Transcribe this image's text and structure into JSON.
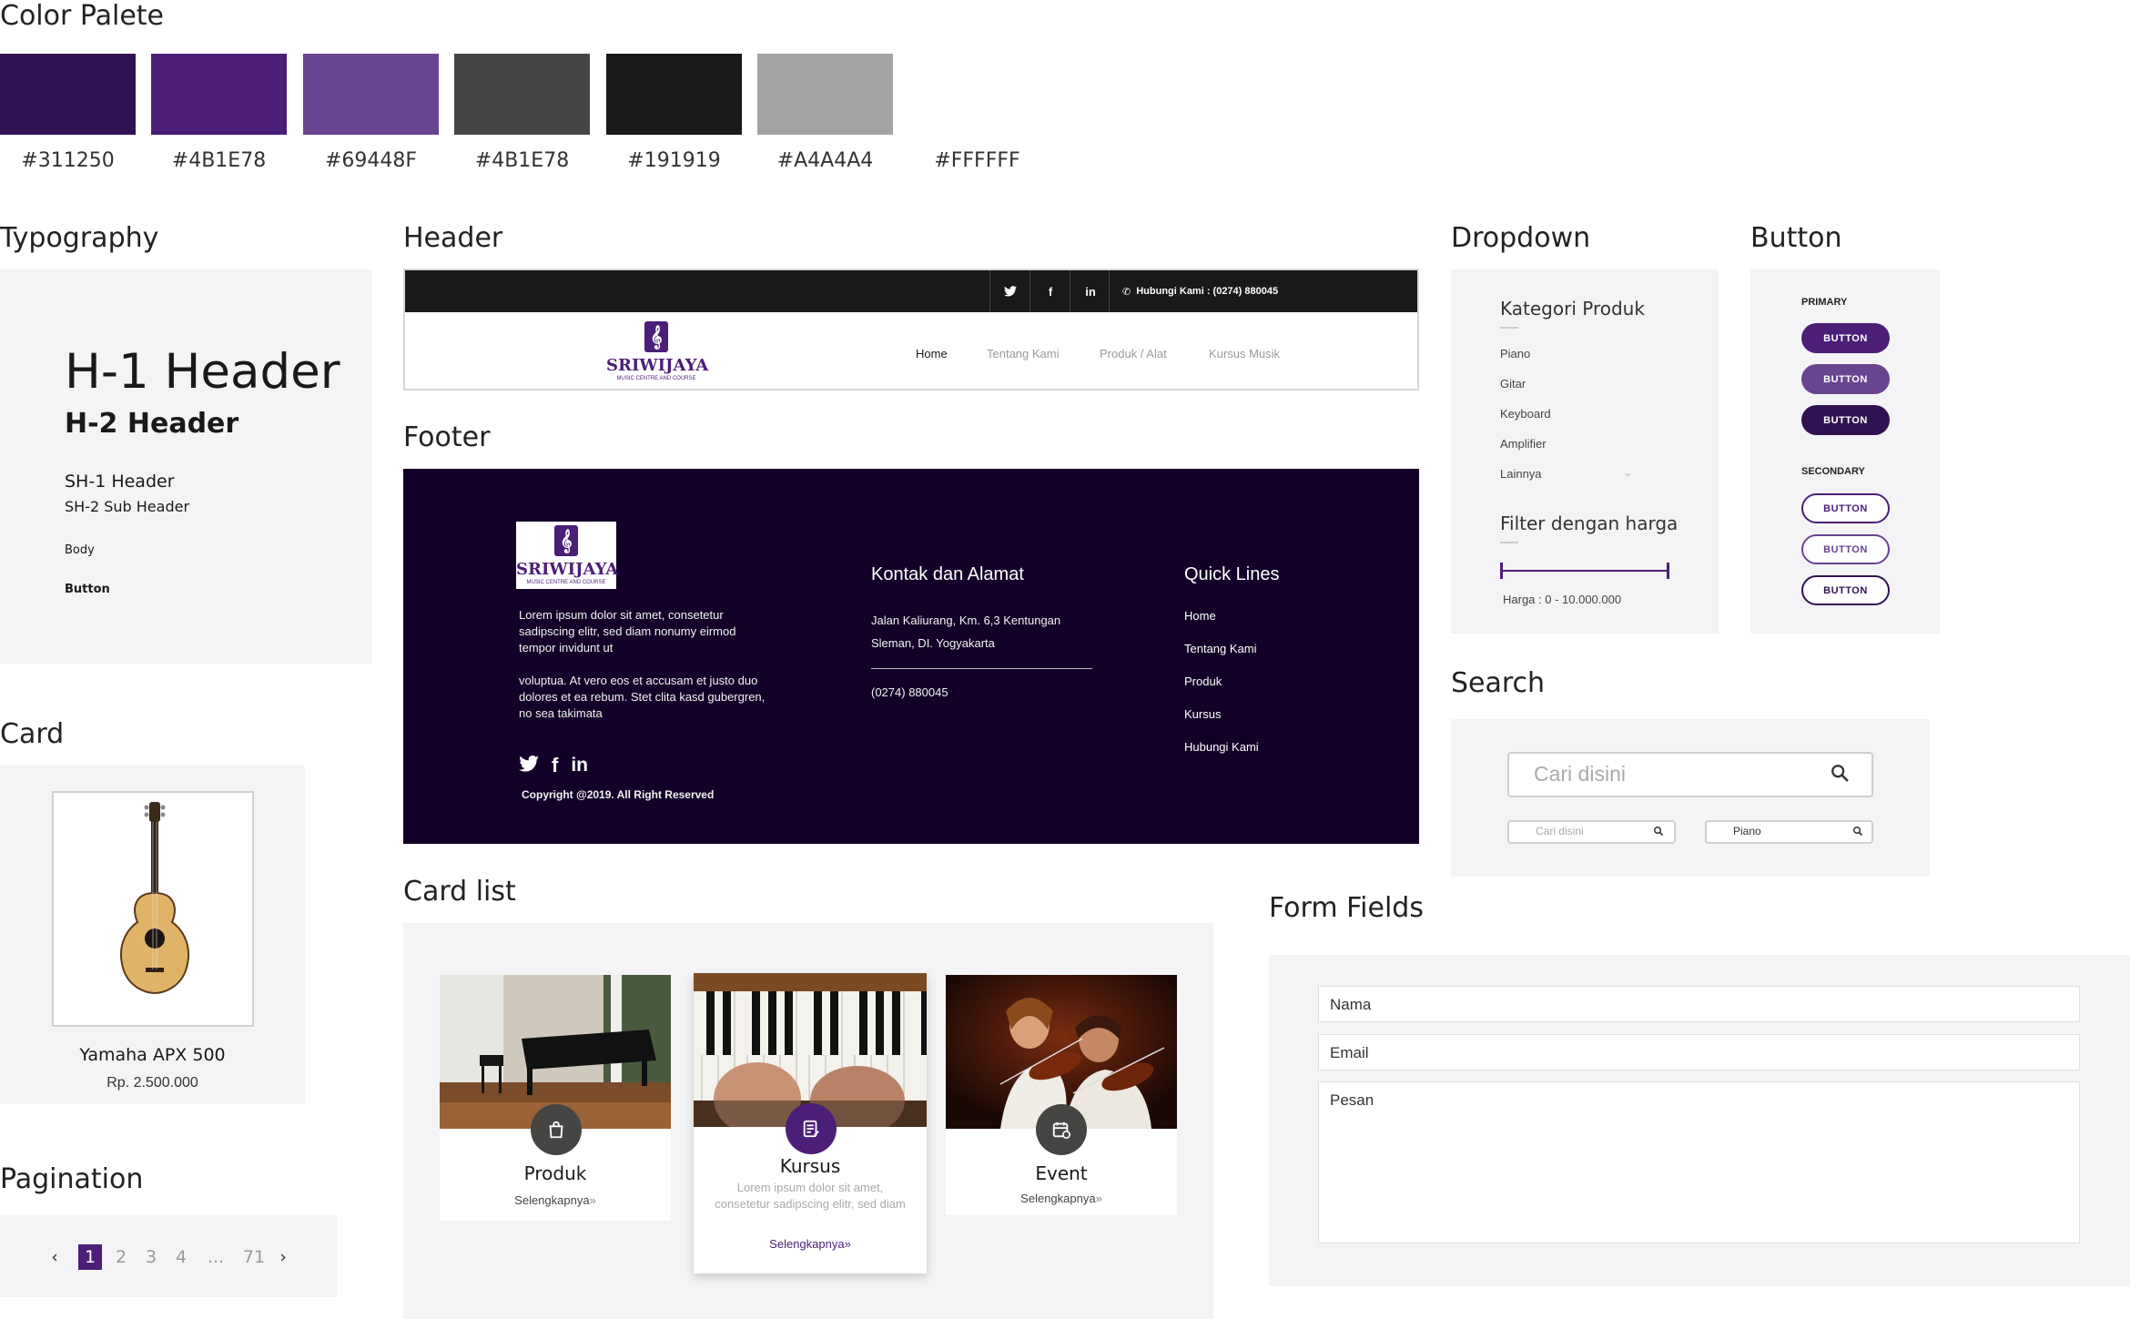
{
  "palette": {
    "title": "Color Palete",
    "swatches": [
      {
        "hex": "#311250",
        "label": "#311250"
      },
      {
        "hex": "#4B1E78",
        "label": "#4B1E78"
      },
      {
        "hex": "#69448F",
        "label": "#69448F"
      },
      {
        "hex": "#454543",
        "label": "#4B1E78"
      },
      {
        "hex": "#191919",
        "label": "#191919"
      },
      {
        "hex": "#A4A4A4",
        "label": "#A4A4A4"
      },
      {
        "hex": "#FFFFFF",
        "label": "#FFFFFF"
      }
    ]
  },
  "typography": {
    "title": "Typography",
    "h1": "H-1 Header",
    "h2": "H-2 Header",
    "sh1": "SH-1 Header",
    "sh2": "SH-2 Sub Header",
    "body": "Body",
    "button": "Button"
  },
  "header": {
    "title": "Header",
    "social": [
      "twitter-icon",
      "facebook-icon",
      "linkedin-icon"
    ],
    "social_glyphs": [
      "🐦",
      "f",
      "in"
    ],
    "contact": "Hubungi Kami : (0274) 880045",
    "nav": [
      "Home",
      "Tentang Kami",
      "Produk / Alat",
      "Kursus Musik"
    ],
    "active_nav": "Home"
  },
  "logo": {
    "name": "SRIWIJAYA",
    "sub": "MUSIC CENTRE AND COURSE"
  },
  "footer": {
    "title": "Footer",
    "para1": "Lorem ipsum dolor sit amet, consetetur sadipscing elitr, sed diam nonumy eirmod tempor invidunt ut",
    "para2": "voluptua. At vero eos et accusam et justo duo dolores et ea rebum. Stet clita kasd gubergren, no sea takimata",
    "copyright": "Copyright @2019. All Right Reserved",
    "contact_title": "Kontak dan Alamat",
    "address1": "Jalan Kaliurang, Km. 6,3 Kentungan",
    "address2": "Sleman, DI. Yogyakarta",
    "phone": "(0274) 880045",
    "links_title": "Quick Lines",
    "links": [
      "Home",
      "Tentang Kami",
      "Produk",
      "Kursus",
      "Hubungi Kami"
    ]
  },
  "dropdown": {
    "title": "Dropdown",
    "category_title": "Kategori Produk",
    "items": [
      "Piano",
      "Gitar",
      "Keyboard",
      "Amplifier",
      "Lainnya"
    ],
    "filter_title": "Filter dengan harga",
    "range_min": 0,
    "range_max": 10000000,
    "price_label": "Harga : 0 - 10.000.000"
  },
  "buttons": {
    "title": "Button",
    "primary_label": "PRIMARY",
    "secondary_label": "SECONDARY",
    "primary": [
      "BUTTON",
      "BUTTON",
      "BUTTON"
    ],
    "secondary": [
      "BUTTON",
      "BUTTON",
      "BUTTON"
    ]
  },
  "search": {
    "title": "Search",
    "placeholder_big": "Cari disini",
    "placeholder_small": "Cari disini",
    "value_small": "Piano"
  },
  "card": {
    "title": "Card",
    "product_name": "Yamaha APX 500",
    "price": "Rp. 2.500.000"
  },
  "pagination": {
    "title": "Pagination",
    "pages": [
      "1",
      "2",
      "3",
      "4",
      "...",
      "71"
    ],
    "current": "1"
  },
  "card_list": {
    "title": "Card list",
    "cards": [
      {
        "title": "Produk",
        "link": "Selengkapnya",
        "icon": "shopping-bag-icon"
      },
      {
        "title": "Kursus",
        "desc": "Lorem ipsum dolor sit amet, consetetur sadipscing elitr, sed diam",
        "link": "Selengkapnya",
        "icon": "document-icon"
      },
      {
        "title": "Event",
        "link": "Selengkapnya",
        "icon": "calendar-icon"
      }
    ]
  },
  "form": {
    "title": "Form Fields",
    "name": "Nama",
    "email": "Email",
    "message": "Pesan"
  },
  "colors": {
    "primary": "#4B1E78",
    "dark_purple": "#311250",
    "light_purple": "#69448F",
    "footer_bg": "#120028"
  }
}
